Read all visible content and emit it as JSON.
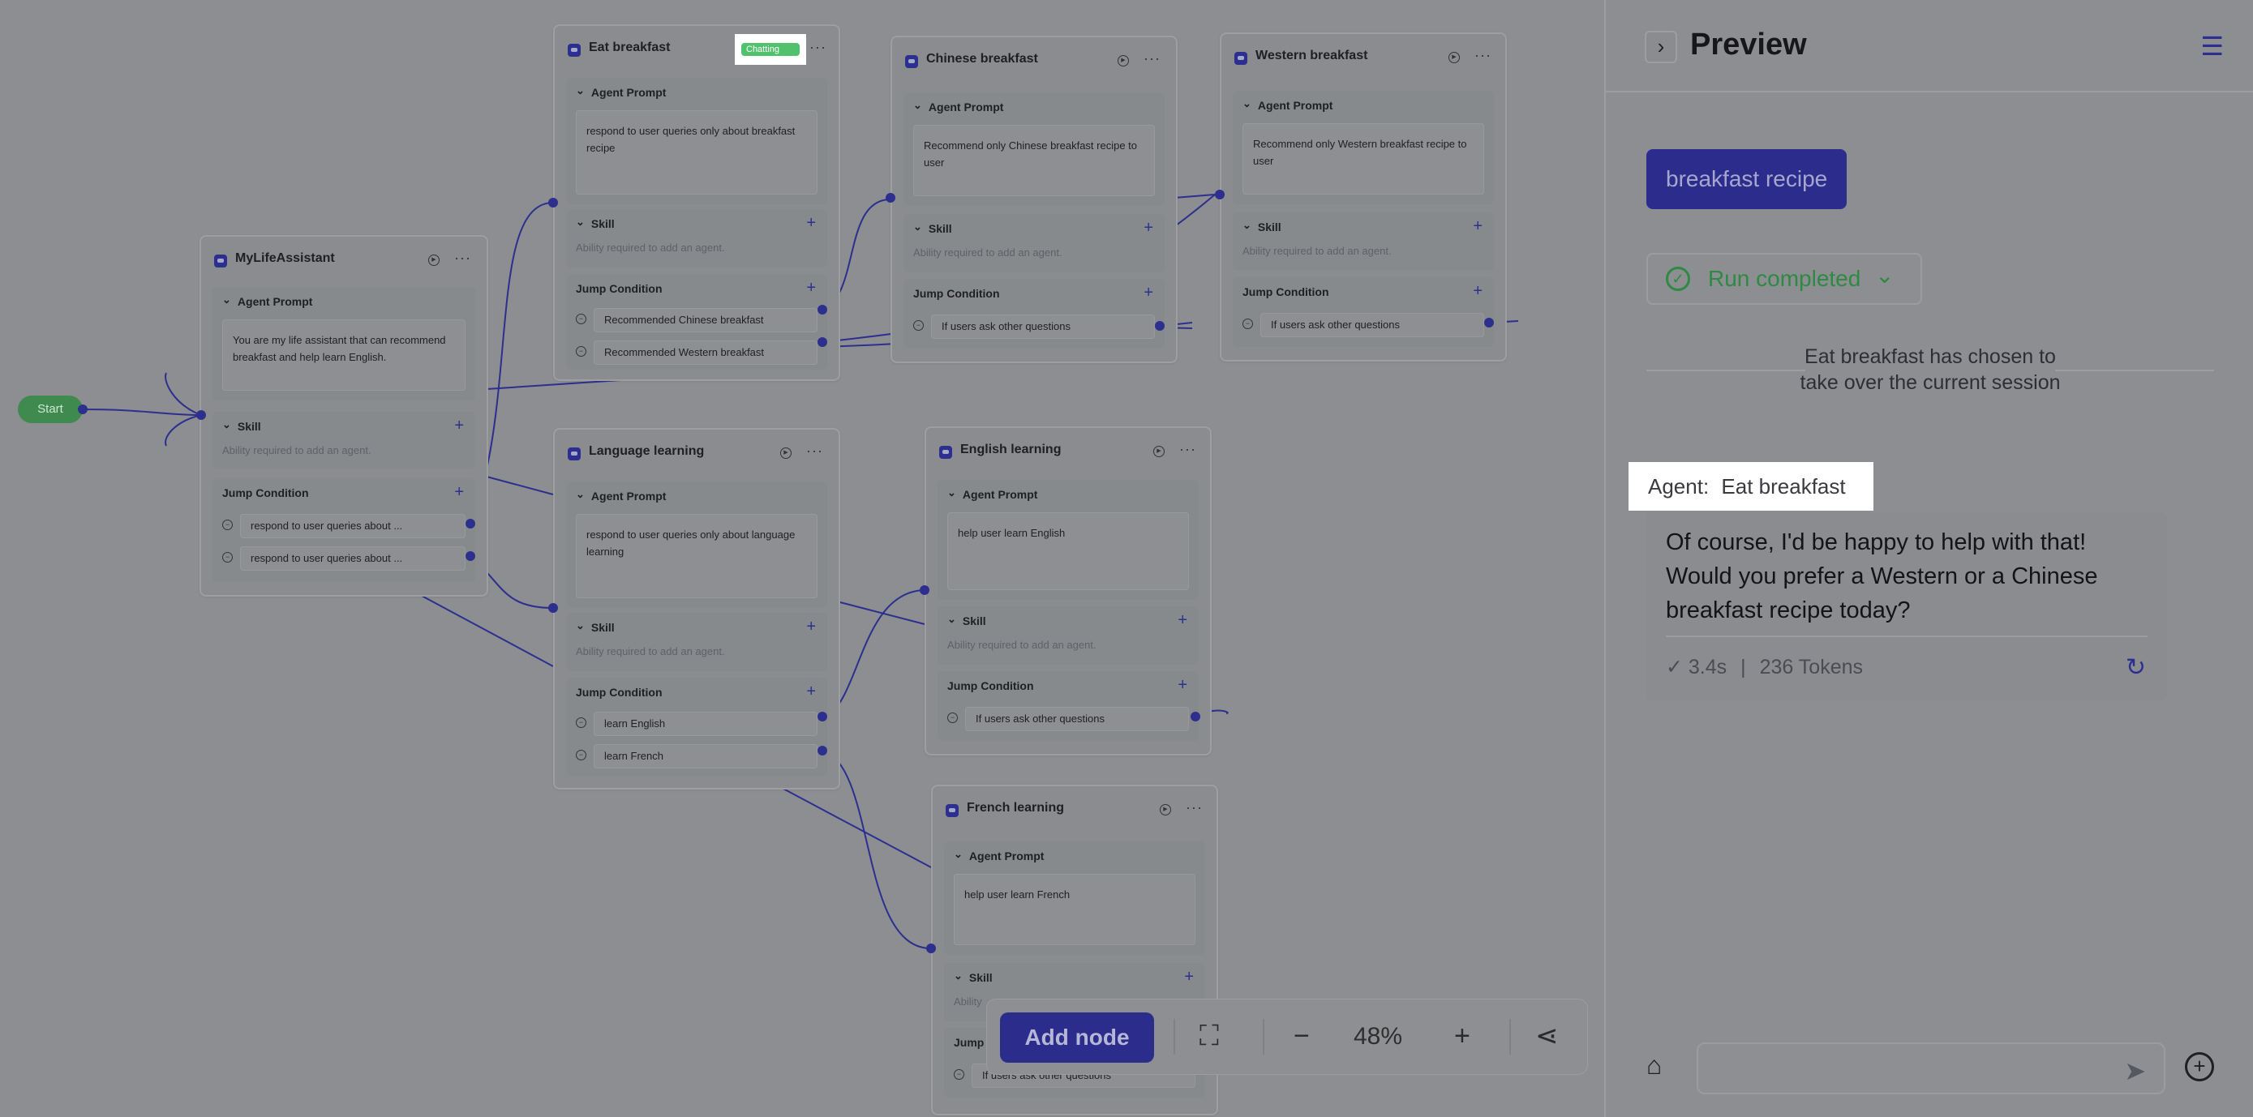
{
  "canvas": {
    "start_label": "Start",
    "nodes": {
      "mylife": {
        "title": "MyLifeAssistant",
        "prompt_label": "Agent Prompt",
        "prompt": "You are my life assistant that can recommend breakfast and help learn English.",
        "skill_label": "Skill",
        "skill_hint": "Ability required to add an agent.",
        "jump_label": "Jump Condition",
        "conditions": [
          "respond to user queries about ...",
          "respond to user queries about ..."
        ]
      },
      "eat": {
        "title": "Eat breakfast",
        "badge": "Chatting",
        "prompt_label": "Agent Prompt",
        "prompt": "respond to user queries only about breakfast recipe",
        "skill_label": "Skill",
        "skill_hint": "Ability required to add an agent.",
        "jump_label": "Jump Condition",
        "conditions": [
          "Recommended Chinese breakfast",
          "Recommended Western breakfast"
        ]
      },
      "chinese": {
        "title": "Chinese breakfast",
        "prompt_label": "Agent Prompt",
        "prompt": "Recommend only Chinese breakfast recipe to user",
        "skill_label": "Skill",
        "skill_hint": "Ability required to add an agent.",
        "jump_label": "Jump Condition",
        "conditions": [
          "If users ask other questions"
        ]
      },
      "western": {
        "title": "Western breakfast",
        "prompt_label": "Agent Prompt",
        "prompt": "Recommend only Western breakfast recipe to user",
        "skill_label": "Skill",
        "skill_hint": "Ability required to add an agent.",
        "jump_label": "Jump Condition",
        "conditions": [
          "If users ask other questions"
        ]
      },
      "language": {
        "title": "Language learning",
        "prompt_label": "Agent Prompt",
        "prompt": "respond to user queries only about language learning",
        "skill_label": "Skill",
        "skill_hint": "Ability required to add an agent.",
        "jump_label": "Jump Condition",
        "conditions": [
          "learn English",
          "learn French"
        ]
      },
      "english": {
        "title": "English learning",
        "prompt_label": "Agent Prompt",
        "prompt": "help user learn English",
        "skill_label": "Skill",
        "skill_hint": "Ability required to add an agent.",
        "jump_label": "Jump Condition",
        "conditions": [
          "If users ask other questions"
        ]
      },
      "french": {
        "title": "French learning",
        "prompt_label": "Agent Prompt",
        "prompt": "help user learn French",
        "skill_label": "Skill",
        "skill_hint": "Ability",
        "jump_label": "Jump",
        "conditions": [
          "If users ask other questions"
        ]
      }
    }
  },
  "toolbar": {
    "add_node": "Add node",
    "zoom": "48%",
    "icons": [
      "fit-view-icon",
      "zoom-out-icon",
      "zoom-in-icon",
      "layout-icon"
    ]
  },
  "panel": {
    "title": "Preview",
    "user_message": "breakfast recipe",
    "run_status": "Run completed",
    "takeover": "Eat breakfast has chosen to take over the current session",
    "agent_prefix": "Agent:",
    "agent_name": "Eat breakfast",
    "reply": "Of course, I'd be happy to help with that! Would you prefer a Western or a Chinese breakfast recipe today?",
    "time": "3.4s",
    "tokens": "236 Tokens"
  },
  "colors": {
    "accent": "#2d2f8e",
    "success": "#2e8a43",
    "badge": "#52c16d"
  }
}
